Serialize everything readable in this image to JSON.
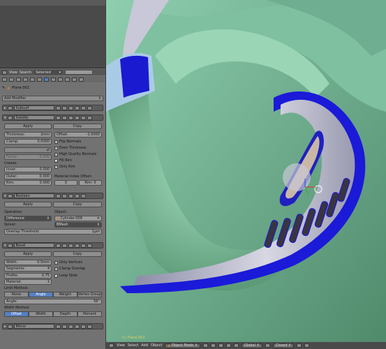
{
  "outliner": {
    "view": "View",
    "search": "Search",
    "filter": "Selected"
  },
  "props": {
    "object_name": "Plane.002",
    "add_modifier": "Add Modifier"
  },
  "subsurf": {
    "name": "Subsurf"
  },
  "solidify": {
    "name": "Solidify",
    "apply": "Apply",
    "copy": "Copy",
    "thickness_label": "Thickness:",
    "thickness": "2mm",
    "offset_label": "Offset:",
    "offset": "-1.0000",
    "clamp_label": "Clamp:",
    "clamp": "0.0000",
    "flip": "Flip Normals",
    "even": "Even Thickness",
    "hq": "High Quality Normals",
    "fill_rim": "Fill Rim",
    "only_rim": "Only Rim",
    "factor_label": "Factor:",
    "factor": "0.000",
    "crease": "Crease:",
    "inner_label": "Inner:",
    "inner": "0.000",
    "outer_label": "Outer:",
    "outer": "0.000",
    "rim_label": "Rim:",
    "rim": "0.000",
    "mio": "Material Index Offset:",
    "mio_a": "0",
    "mio_b": "Rim: 0"
  },
  "boolean": {
    "name": "Boolean",
    "apply": "Apply",
    "copy": "Copy",
    "operation": "Operation:",
    "op_value": "Difference",
    "object": "Object:",
    "object_value": "Cylinder.009",
    "solver": "Solver:",
    "solver_value": "BMesh",
    "overlap_label": "Overlap Threshold:",
    "overlap": "1µm"
  },
  "bevel": {
    "name": "Bevel",
    "apply": "Apply",
    "copy": "Copy",
    "width_label": "Width:",
    "width": "0.5mm",
    "segments_label": "Segments:",
    "segments": "4",
    "profile_label": "Profile:",
    "profile": "0.75",
    "material_label": "Material:",
    "material": "1",
    "only_vertices": "Only Vertices",
    "clamp_overlap": "Clamp Overlap",
    "loop_slide": "Loop Slide",
    "limit_method": "Limit Method:",
    "limits": [
      "None",
      "Angle",
      "Weight",
      "Vertex Group"
    ],
    "angle_label": "Angle:",
    "angle": "56°",
    "width_method": "Width Method:",
    "width_methods": [
      "Offset",
      "Width",
      "Depth",
      "Percent"
    ]
  },
  "mirror": {
    "name": "Mirror"
  },
  "viewport": {
    "object_label": "(1) Plane.002"
  },
  "bottom": {
    "view": "View",
    "select": "Select",
    "add": "Add",
    "object": "Object",
    "mode": "Object Mode",
    "orientation": "Global",
    "closed": "Closed"
  },
  "colors": {
    "accent": "#5680c2",
    "panel": "#727272",
    "viewport": "#5e8f74"
  }
}
